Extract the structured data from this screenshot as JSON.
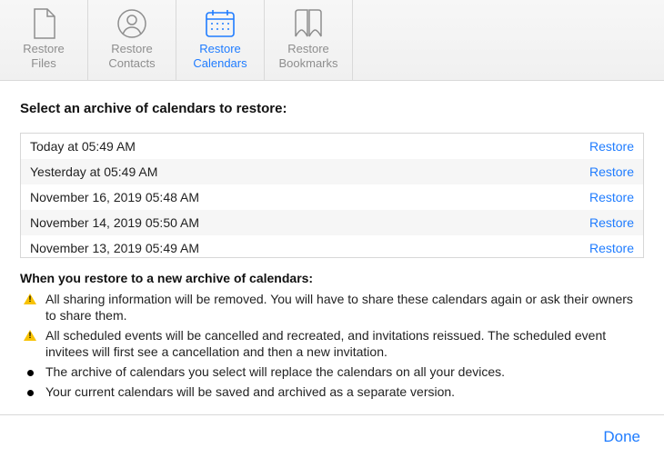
{
  "tabs": [
    {
      "id": "files",
      "line1": "Restore",
      "line2": "Files",
      "iconName": "file-icon",
      "active": false
    },
    {
      "id": "contacts",
      "line1": "Restore",
      "line2": "Contacts",
      "iconName": "contact-icon",
      "active": false
    },
    {
      "id": "calendars",
      "line1": "Restore",
      "line2": "Calendars",
      "iconName": "calendar-icon",
      "active": true
    },
    {
      "id": "bookmarks",
      "line1": "Restore",
      "line2": "Bookmarks",
      "iconName": "bookmark-icon",
      "active": false
    }
  ],
  "headline": "Select an archive of calendars to restore:",
  "archives": [
    {
      "label": "Today at 05:49 AM",
      "action": "Restore"
    },
    {
      "label": "Yesterday at 05:49 AM",
      "action": "Restore"
    },
    {
      "label": "November 16, 2019 05:48 AM",
      "action": "Restore"
    },
    {
      "label": "November 14, 2019 05:50 AM",
      "action": "Restore"
    },
    {
      "label": "November 13, 2019 05:49 AM",
      "action": "Restore"
    }
  ],
  "notesTitle": "When you restore to a new archive of calendars:",
  "notes": [
    {
      "kind": "warn",
      "text": "All sharing information will be removed. You will have to share these calendars again or ask their owners to share them."
    },
    {
      "kind": "warn",
      "text": "All scheduled events will be cancelled and recreated, and invitations reissued. The scheduled event invitees will first see a cancellation and then a new invitation."
    },
    {
      "kind": "bullet",
      "text": "The archive of calendars you select will replace the calendars on all your devices."
    },
    {
      "kind": "bullet",
      "text": "Your current calendars will be saved and archived as a separate version."
    }
  ],
  "doneLabel": "Done",
  "colors": {
    "accent": "#1f7cff",
    "muted": "#8e8e8e"
  }
}
